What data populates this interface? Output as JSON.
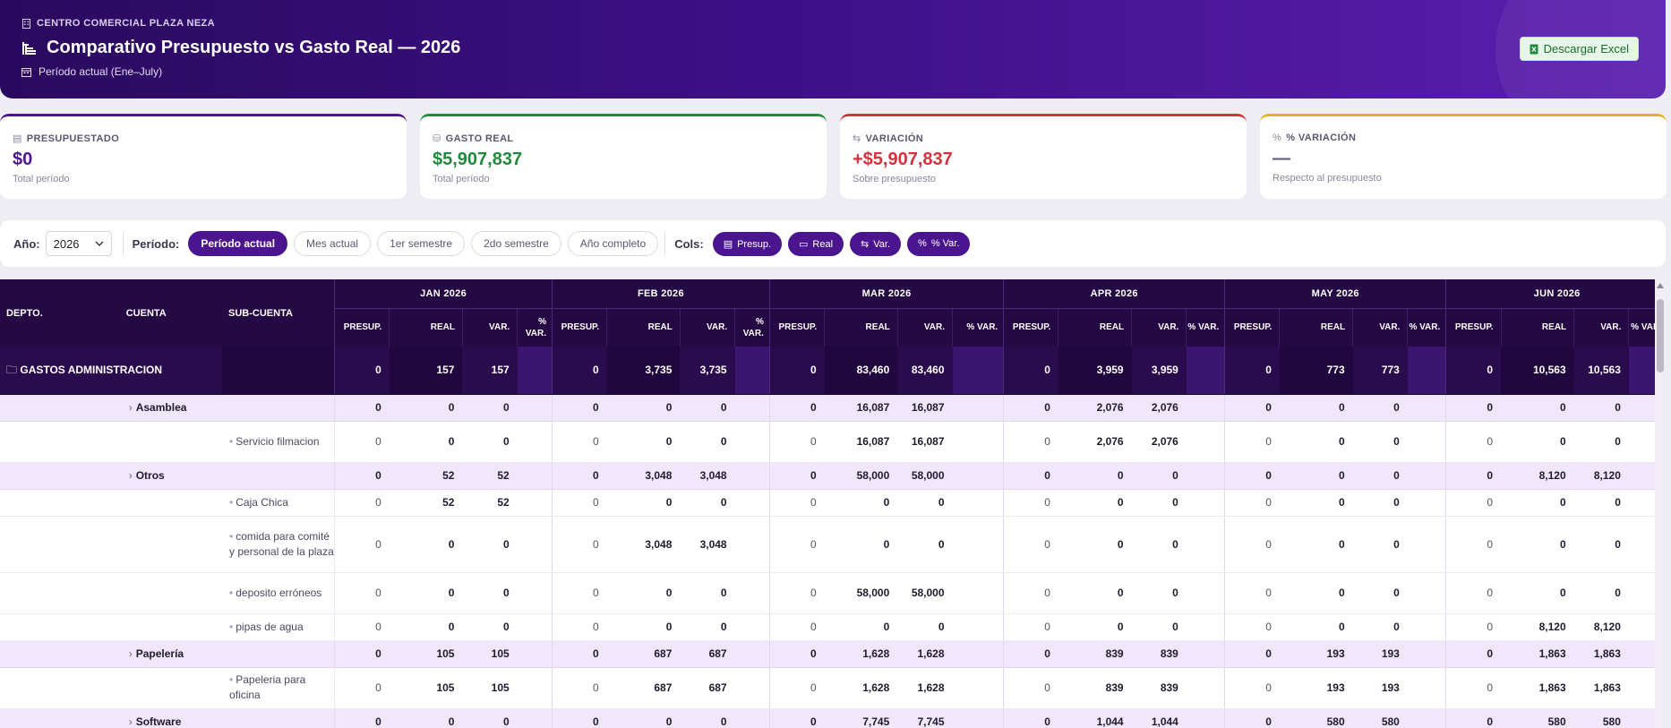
{
  "header": {
    "org": "CENTRO COMERCIAL PLAZA NEZA",
    "title": "Comparativo Presupuesto vs Gasto Real — 2026",
    "period": "Período actual (Ene–July)",
    "download_label": "Descargar Excel"
  },
  "kpis": [
    {
      "label": "PRESUPUESTADO",
      "value": "$0",
      "sub": "Total período",
      "color": "#4b1590"
    },
    {
      "label": "GASTO REAL",
      "value": "$5,907,837",
      "sub": "Total período",
      "color": "#1f8a3c"
    },
    {
      "label": "VARIACIÓN",
      "value": "+$5,907,837",
      "sub": "Sobre presupuesto",
      "color": "#d6303b"
    },
    {
      "label": "% VARIACIÓN",
      "value": "—",
      "sub": "Respecto al presupuesto",
      "color": "#e2b31a"
    }
  ],
  "filters": {
    "year_label": "Año:",
    "year_value": "2026",
    "period_label": "Período:",
    "periods": [
      "Período actual",
      "Mes actual",
      "1er semestre",
      "2do semestre",
      "Año completo"
    ],
    "active_period": "Período actual",
    "cols_label": "Cols:",
    "cols": [
      "Presup.",
      "Real",
      "Var.",
      "% Var."
    ]
  },
  "table": {
    "fixed_headers": [
      "DEPTO.",
      "CUENTA",
      "SUB-CUENTA"
    ],
    "months": [
      "JAN 2026",
      "FEB 2026",
      "MAR 2026",
      "APR 2026",
      "MAY 2026",
      "JUN 2026"
    ],
    "sub_headers": [
      "PRESUP.",
      "REAL",
      "VAR.",
      "% VAR."
    ],
    "rows": [
      {
        "type": "dept",
        "name": "GASTOS ADMINISTRACION",
        "values": [
          [
            "0",
            "157",
            "157"
          ],
          [
            "0",
            "3,735",
            "3,735"
          ],
          [
            "0",
            "83,460",
            "83,460"
          ],
          [
            "0",
            "3,959",
            "3,959"
          ],
          [
            "0",
            "773",
            "773"
          ],
          [
            "0",
            "10,563",
            "10,563"
          ]
        ]
      },
      {
        "type": "cuenta",
        "name": "Asamblea",
        "values": [
          [
            "0",
            "0",
            "0"
          ],
          [
            "0",
            "0",
            "0"
          ],
          [
            "0",
            "16,087",
            "16,087"
          ],
          [
            "0",
            "2,076",
            "2,076"
          ],
          [
            "0",
            "0",
            "0"
          ],
          [
            "0",
            "0",
            "0"
          ]
        ]
      },
      {
        "type": "sub",
        "name": "Servicio filmacion",
        "lines": 2,
        "values": [
          [
            "0",
            "0",
            "0"
          ],
          [
            "0",
            "0",
            "0"
          ],
          [
            "0",
            "16,087",
            "16,087"
          ],
          [
            "0",
            "2,076",
            "2,076"
          ],
          [
            "0",
            "0",
            "0"
          ],
          [
            "0",
            "0",
            "0"
          ]
        ]
      },
      {
        "type": "cuenta",
        "name": "Otros",
        "values": [
          [
            "0",
            "52",
            "52"
          ],
          [
            "0",
            "3,048",
            "3,048"
          ],
          [
            "0",
            "58,000",
            "58,000"
          ],
          [
            "0",
            "0",
            "0"
          ],
          [
            "0",
            "0",
            "0"
          ],
          [
            "0",
            "8,120",
            "8,120"
          ]
        ]
      },
      {
        "type": "sub",
        "name": "Caja Chica",
        "lines": 1,
        "values": [
          [
            "0",
            "52",
            "52"
          ],
          [
            "0",
            "0",
            "0"
          ],
          [
            "0",
            "0",
            "0"
          ],
          [
            "0",
            "0",
            "0"
          ],
          [
            "0",
            "0",
            "0"
          ],
          [
            "0",
            "0",
            "0"
          ]
        ]
      },
      {
        "type": "sub",
        "name": "comida para comité y personal de la plaza",
        "lines": 3,
        "values": [
          [
            "0",
            "0",
            "0"
          ],
          [
            "0",
            "3,048",
            "3,048"
          ],
          [
            "0",
            "0",
            "0"
          ],
          [
            "0",
            "0",
            "0"
          ],
          [
            "0",
            "0",
            "0"
          ],
          [
            "0",
            "0",
            "0"
          ]
        ]
      },
      {
        "type": "sub",
        "name": "deposito erróneos",
        "lines": 2,
        "values": [
          [
            "0",
            "0",
            "0"
          ],
          [
            "0",
            "0",
            "0"
          ],
          [
            "0",
            "58,000",
            "58,000"
          ],
          [
            "0",
            "0",
            "0"
          ],
          [
            "0",
            "0",
            "0"
          ],
          [
            "0",
            "0",
            "0"
          ]
        ]
      },
      {
        "type": "sub",
        "name": "pipas de agua",
        "lines": 1,
        "values": [
          [
            "0",
            "0",
            "0"
          ],
          [
            "0",
            "0",
            "0"
          ],
          [
            "0",
            "0",
            "0"
          ],
          [
            "0",
            "0",
            "0"
          ],
          [
            "0",
            "0",
            "0"
          ],
          [
            "0",
            "8,120",
            "8,120"
          ]
        ]
      },
      {
        "type": "cuenta",
        "name": "Papelería",
        "values": [
          [
            "0",
            "105",
            "105"
          ],
          [
            "0",
            "687",
            "687"
          ],
          [
            "0",
            "1,628",
            "1,628"
          ],
          [
            "0",
            "839",
            "839"
          ],
          [
            "0",
            "193",
            "193"
          ],
          [
            "0",
            "1,863",
            "1,863"
          ]
        ]
      },
      {
        "type": "sub",
        "name": "Papeleria para oficina",
        "lines": 2,
        "values": [
          [
            "0",
            "105",
            "105"
          ],
          [
            "0",
            "687",
            "687"
          ],
          [
            "0",
            "1,628",
            "1,628"
          ],
          [
            "0",
            "839",
            "839"
          ],
          [
            "0",
            "193",
            "193"
          ],
          [
            "0",
            "1,863",
            "1,863"
          ]
        ]
      },
      {
        "type": "cuenta",
        "name": "Software",
        "values": [
          [
            "0",
            "0",
            "0"
          ],
          [
            "0",
            "0",
            "0"
          ],
          [
            "0",
            "7,745",
            "7,745"
          ],
          [
            "0",
            "1,044",
            "1,044"
          ],
          [
            "0",
            "580",
            "580"
          ],
          [
            "0",
            "580",
            "580"
          ]
        ]
      }
    ]
  }
}
